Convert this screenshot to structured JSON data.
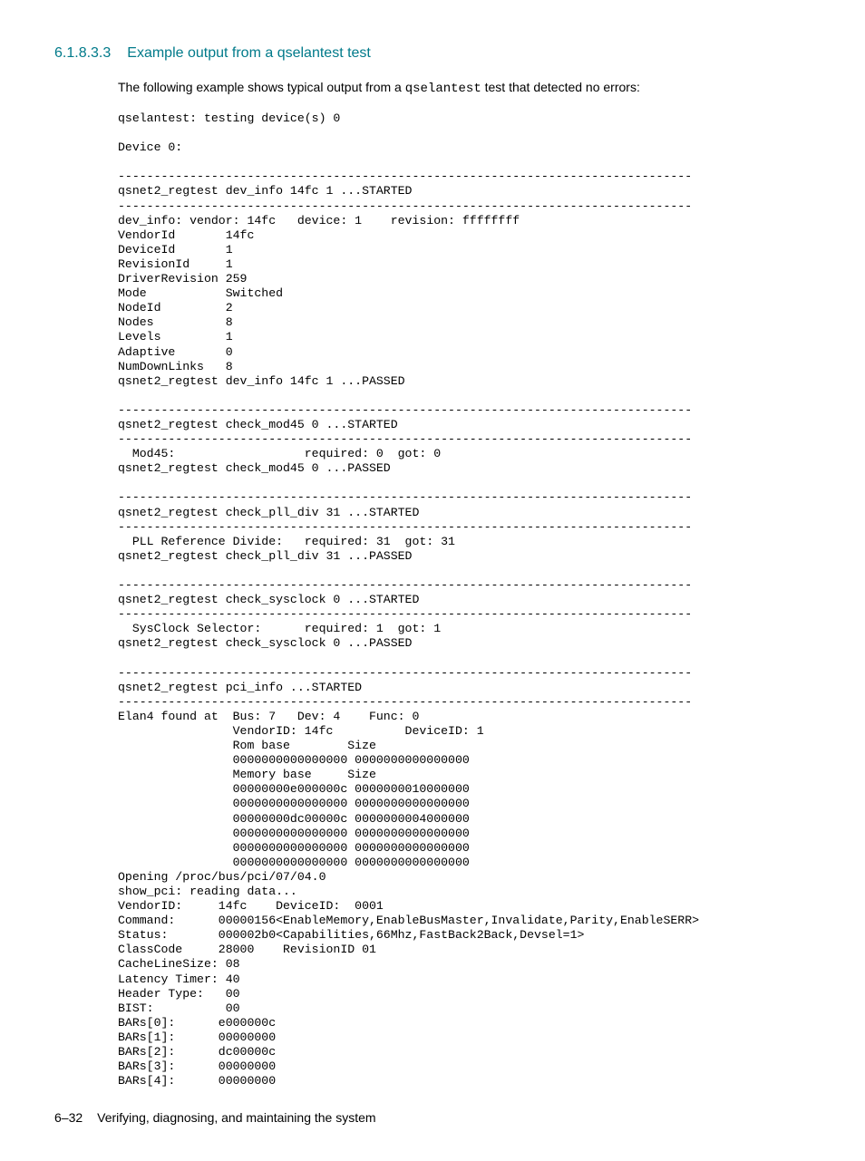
{
  "heading": {
    "number": "6.1.8.3.3",
    "title": "Example output from a qselantest test"
  },
  "intro": {
    "prefix": "The following example shows typical output from a ",
    "cmd": "qselantest",
    "suffix": " test that detected no errors:"
  },
  "code": "qselantest: testing device(s) 0\n\nDevice 0:\n\n--------------------------------------------------------------------------------\nqsnet2_regtest dev_info 14fc 1 ...STARTED\n--------------------------------------------------------------------------------\ndev_info: vendor: 14fc   device: 1    revision: ffffffff\nVendorId       14fc\nDeviceId       1\nRevisionId     1\nDriverRevision 259\nMode           Switched\nNodeId         2\nNodes          8\nLevels         1\nAdaptive       0\nNumDownLinks   8\nqsnet2_regtest dev_info 14fc 1 ...PASSED\n\n--------------------------------------------------------------------------------\nqsnet2_regtest check_mod45 0 ...STARTED\n--------------------------------------------------------------------------------\n  Mod45:                  required: 0  got: 0\nqsnet2_regtest check_mod45 0 ...PASSED\n\n--------------------------------------------------------------------------------\nqsnet2_regtest check_pll_div 31 ...STARTED\n--------------------------------------------------------------------------------\n  PLL Reference Divide:   required: 31  got: 31\nqsnet2_regtest check_pll_div 31 ...PASSED\n\n--------------------------------------------------------------------------------\nqsnet2_regtest check_sysclock 0 ...STARTED\n--------------------------------------------------------------------------------\n  SysClock Selector:      required: 1  got: 1\nqsnet2_regtest check_sysclock 0 ...PASSED\n\n--------------------------------------------------------------------------------\nqsnet2_regtest pci_info ...STARTED\n--------------------------------------------------------------------------------\nElan4 found at  Bus: 7   Dev: 4    Func: 0\n                VendorID: 14fc          DeviceID: 1\n                Rom base        Size\n                0000000000000000 0000000000000000\n                Memory base     Size\n                00000000e000000c 0000000010000000\n                0000000000000000 0000000000000000\n                00000000dc00000c 0000000004000000\n                0000000000000000 0000000000000000\n                0000000000000000 0000000000000000\n                0000000000000000 0000000000000000\nOpening /proc/bus/pci/07/04.0\nshow_pci: reading data...\nVendorID:     14fc    DeviceID:  0001\nCommand:      00000156<EnableMemory,EnableBusMaster,Invalidate,Parity,EnableSERR>\nStatus:       000002b0<Capabilities,66Mhz,FastBack2Back,Devsel=1>\nClassCode     28000    RevisionID 01\nCacheLineSize: 08\nLatency Timer: 40\nHeader Type:   00\nBIST:          00\nBARs[0]:      e000000c\nBARs[1]:      00000000\nBARs[2]:      dc00000c\nBARs[3]:      00000000\nBARs[4]:      00000000",
  "footer": {
    "page": "6–32",
    "label": "Verifying, diagnosing, and maintaining the system"
  }
}
